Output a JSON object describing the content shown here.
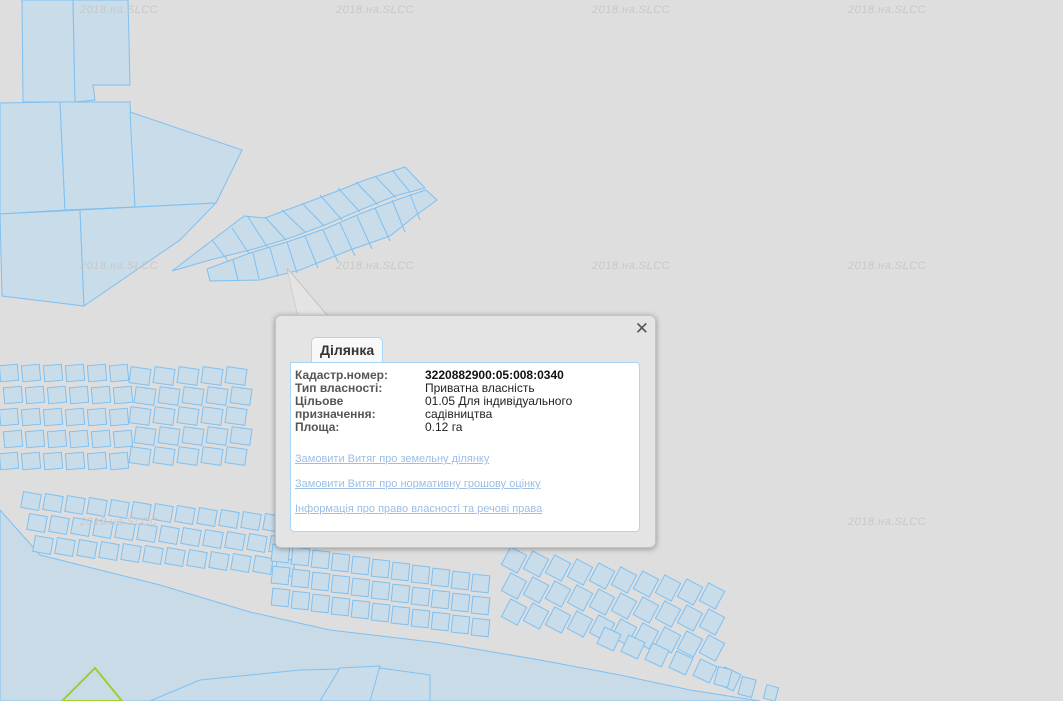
{
  "map": {
    "watermark": "2018.на.SLCC",
    "colors": {
      "background": "#dedede",
      "parcel_fill": "#c9dcea",
      "parcel_stroke": "#7fc0f0",
      "highlight": "#9bd12a"
    }
  },
  "popup": {
    "tab_label": "Ділянка",
    "close_glyph": "✕",
    "fields": [
      {
        "label": "Кадастр.номер:",
        "value": "3220882900:05:008:0340"
      },
      {
        "label": "Тип власності:",
        "value": "Приватна власність"
      },
      {
        "label": "Цільове призначення:",
        "value": "01.05 Для індивідуального садівництва"
      },
      {
        "label": "Площа:",
        "value": "0.12 га"
      }
    ],
    "links": [
      "Замовити Витяг про земельну ділянку",
      "Замовити Витяг про нормативну грошову оцінку",
      "Інформація про право власності та речові права"
    ]
  }
}
